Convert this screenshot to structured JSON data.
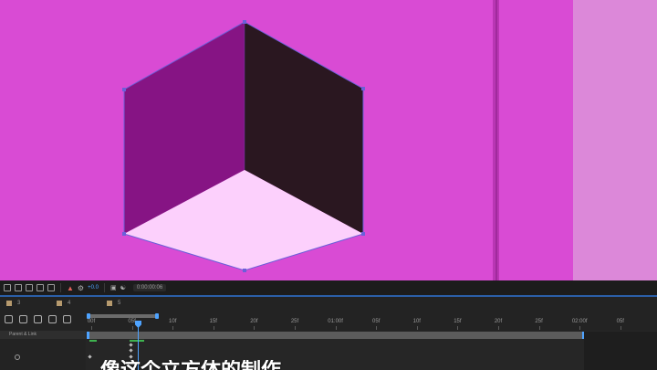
{
  "colors": {
    "canvas_bg": "#d94bd4",
    "right_panel": "#dc88d9",
    "cube_left_face": "#861484",
    "cube_right_face": "#2a1720",
    "cube_bottom_face": "#fcd0fc",
    "cube_outline": "#6b5fd9",
    "ui_dark": "#232323",
    "accent_blue": "#4ea3ff",
    "keyframe_green": "#3fb34f"
  },
  "toolbar": {
    "exposure_value": "+0.0",
    "timecode": "0:00:00:06",
    "icons": [
      "selection-icon",
      "region-icon",
      "mask-icon",
      "toggle-icon",
      "region-of-interest-icon",
      "color-wheel-icon",
      "gear-icon",
      "camera-icon",
      "settings-icon"
    ]
  },
  "layer_tabs": [
    {
      "label": "3"
    },
    {
      "label": "4"
    },
    {
      "label": "5"
    }
  ],
  "timeline": {
    "parent_link_label": "Parent & Link",
    "ruler_labels": [
      "00f",
      "05f",
      "10f",
      "15f",
      "20f",
      "25f",
      "01:00f",
      "05f",
      "10f",
      "15f",
      "20f",
      "25f",
      "02:00f",
      "05f",
      "10f"
    ],
    "current_frame": 6,
    "frames_per_second": 30
  },
  "subtitle": {
    "text": "像这个立方体的制作"
  }
}
